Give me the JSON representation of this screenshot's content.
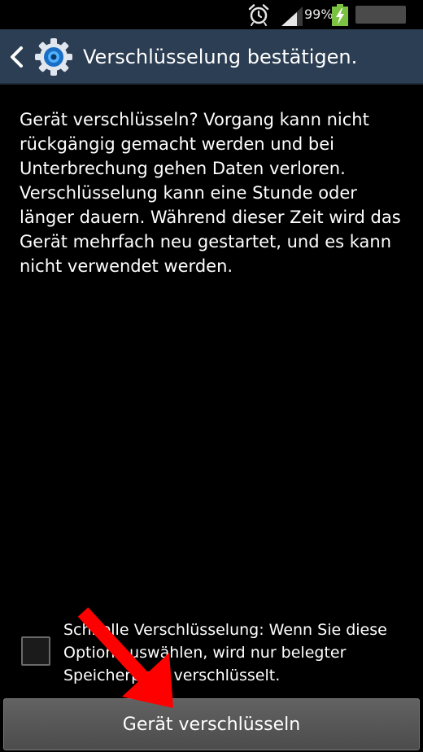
{
  "status_bar": {
    "battery_percent": "99%",
    "icons": [
      "alarm-icon",
      "signal-icon",
      "battery-charging-icon"
    ]
  },
  "header": {
    "title": "Verschlüsselung bestätigen.",
    "icons": [
      "back-chevron-icon",
      "settings-gear-icon"
    ]
  },
  "main": {
    "message": "Gerät verschlüsseln? Vorgang kann nicht rückgängig gemacht werden und bei Unterbrechung gehen Daten verloren. Verschlüsselung kann eine Stunde oder länger dauern. Während dieser Zeit wird das Gerät mehrfach neu gestartet, und es kann nicht verwendet werden."
  },
  "option": {
    "checked": false,
    "label": "Schnelle Verschlüsselung: Wenn Sie diese Option auswählen, wird nur belegter Speicherplatz verschlüsselt."
  },
  "footer": {
    "button_label": "Gerät verschlüsseln"
  },
  "colors": {
    "action_bar": "#2c3e53",
    "annotation_arrow": "#ff0000",
    "battery": "#7cc242"
  }
}
